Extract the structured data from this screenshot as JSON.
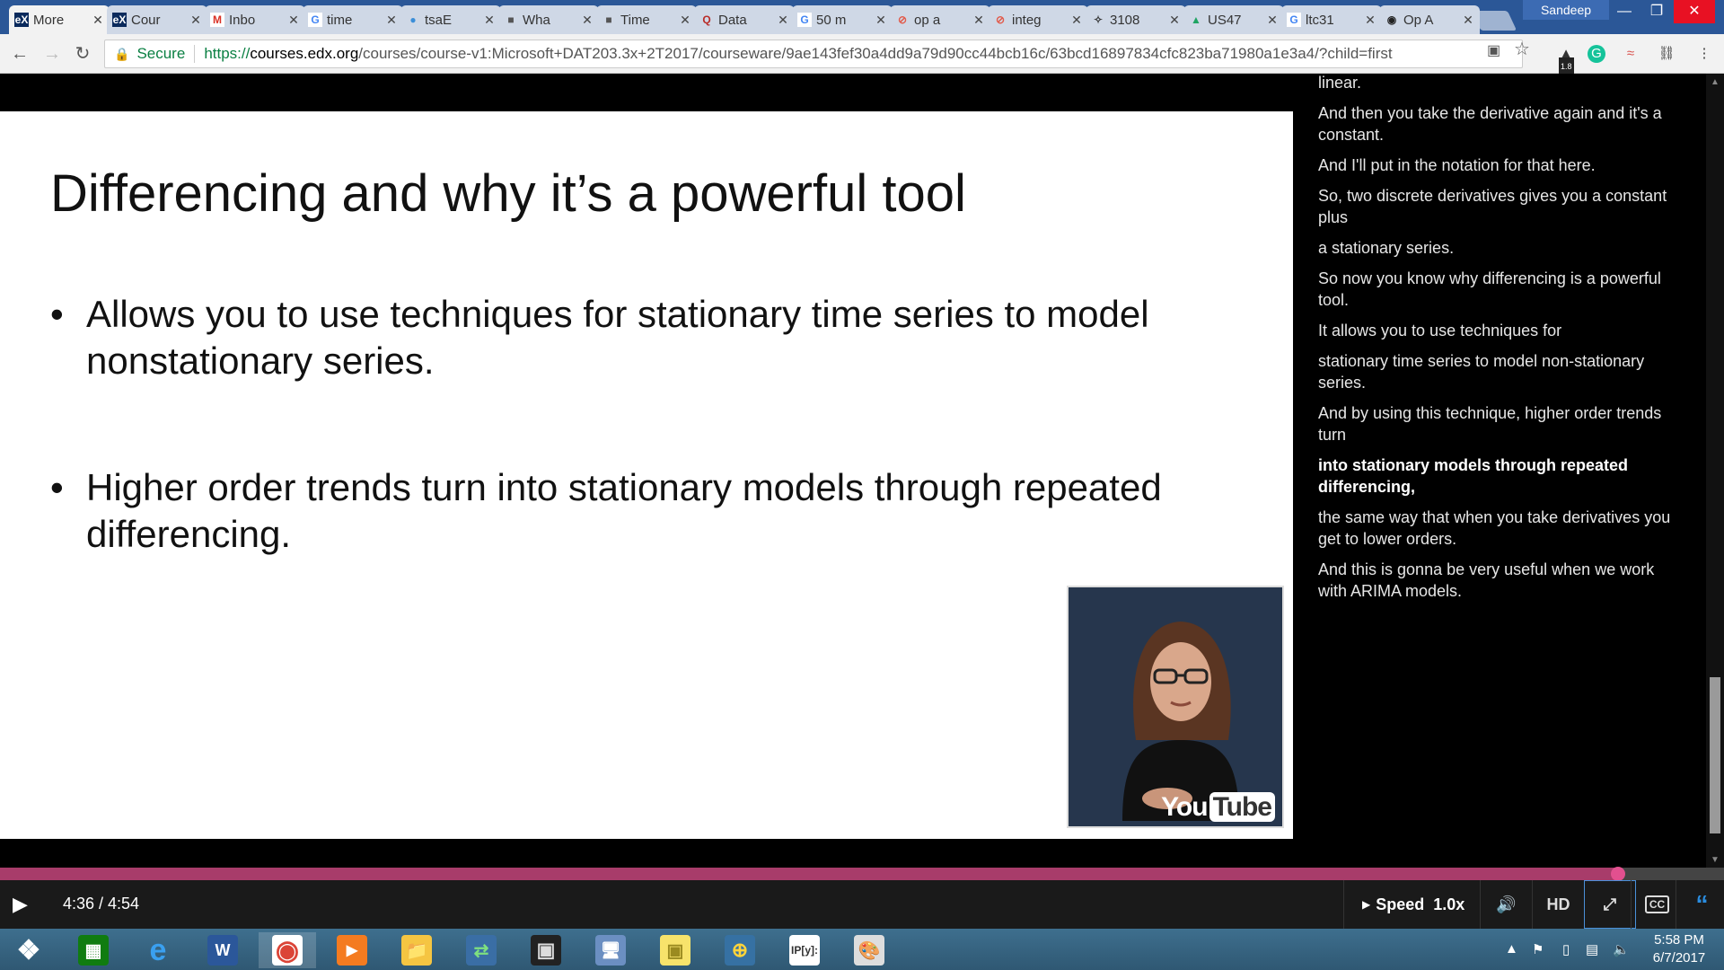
{
  "browser": {
    "tabs": [
      {
        "favicon": "edx-icon",
        "title": "More",
        "active": true
      },
      {
        "favicon": "edx-icon",
        "title": "Cour"
      },
      {
        "favicon": "gmail-icon",
        "title": "Inbo"
      },
      {
        "favicon": "google-icon",
        "title": "time"
      },
      {
        "favicon": "globe-icon",
        "title": "tsaE"
      },
      {
        "favicon": "person-icon",
        "title": "Wha"
      },
      {
        "favicon": "person-icon",
        "title": "Time"
      },
      {
        "favicon": "quora-icon",
        "title": "Data"
      },
      {
        "favicon": "google-icon",
        "title": "50 m"
      },
      {
        "favicon": "stack-icon",
        "title": "op a"
      },
      {
        "favicon": "stack-icon",
        "title": "integ"
      },
      {
        "favicon": "leetcode-icon",
        "title": "3108"
      },
      {
        "favicon": "drive-icon",
        "title": "US47"
      },
      {
        "favicon": "google-icon",
        "title": "ltc31"
      },
      {
        "favicon": "github-icon",
        "title": "Op A"
      }
    ],
    "profile": "Sandeep",
    "secure_label": "Secure",
    "url_scheme": "https://",
    "url_host": "courses.edx.org",
    "url_path": "/courses/course-v1:Microsoft+DAT203.3x+2T2017/courseware/9ae143fef30a4dd9a79d90cc44bcb16c/63bcd16897834cfc823ba71980a1e3a4/?child=first",
    "extension_badge": "1.8"
  },
  "slide": {
    "title": "Differencing and why it’s a powerful tool",
    "bullets": [
      "Allows you to use techniques for stationary time series to model nonstationary series.",
      "Higher order trends turn into stationary models through repeated differencing."
    ],
    "watermark_word1": "You",
    "watermark_word2": "Tube"
  },
  "transcript": {
    "lines": [
      {
        "text": "linear."
      },
      {
        "text": "And then you take the derivative again and it's a constant."
      },
      {
        "text": "And I'll put in the notation for that here."
      },
      {
        "text": "So, two discrete derivatives gives you a constant plus"
      },
      {
        "text": "a stationary series."
      },
      {
        "text": "So now you know why differencing is a powerful tool."
      },
      {
        "text": "It allows you to use techniques for"
      },
      {
        "text": "stationary time series to model non-stationary series."
      },
      {
        "text": "And by using this technique, higher order trends turn"
      },
      {
        "text": "into stationary models through repeated differencing,",
        "current": true
      },
      {
        "text": "the same way that when you take derivatives you get to lower orders."
      },
      {
        "text": "And this is gonna be very useful when we work with ARIMA models."
      }
    ]
  },
  "player": {
    "time_display": "4:36 / 4:54",
    "progress_fraction": 0.9388,
    "speed_label": "Speed",
    "speed_value": "1.0x",
    "hd_label": "HD",
    "cc_label": "CC",
    "colors": {
      "progress": "#a83c6a",
      "handle": "#e2508f",
      "accent": "#2a8de0"
    }
  },
  "taskbar": {
    "apps": [
      {
        "icon": "windows-start-icon"
      },
      {
        "icon": "store-icon"
      },
      {
        "icon": "internet-explorer-icon"
      },
      {
        "icon": "word-icon",
        "letter": "W"
      },
      {
        "icon": "chrome-icon",
        "active": true
      },
      {
        "icon": "media-player-icon"
      },
      {
        "icon": "file-explorer-icon"
      },
      {
        "icon": "remote-icon"
      },
      {
        "icon": "terminal-icon"
      },
      {
        "icon": "network-icon"
      },
      {
        "icon": "sticky-notes-icon"
      },
      {
        "icon": "python-icon"
      },
      {
        "icon": "ipython-icon",
        "letter": "IP[y]:"
      },
      {
        "icon": "paint-icon"
      }
    ],
    "time": "5:58 PM",
    "date": "6/7/2017"
  }
}
